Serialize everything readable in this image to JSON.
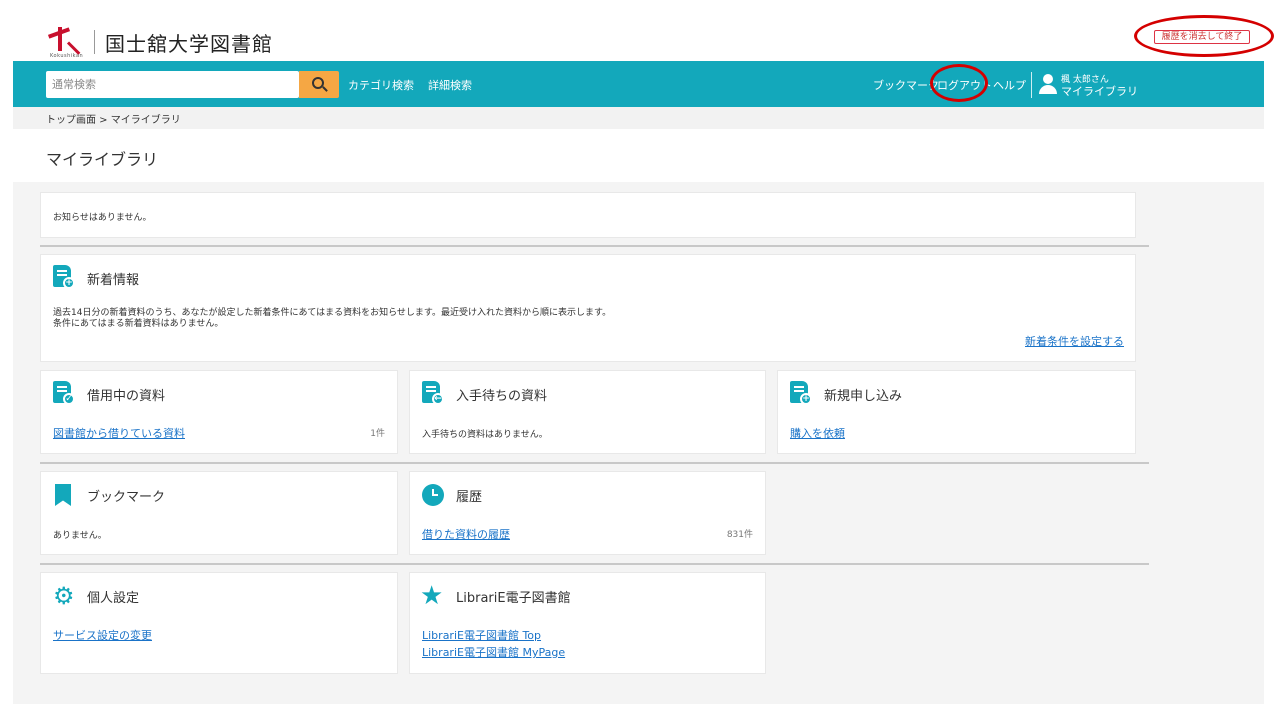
{
  "header": {
    "logo_sub": "Kokushikan",
    "logo_text": "国士舘大学図書館",
    "exit_button": "履歴を消去して終了"
  },
  "nav": {
    "search_placeholder": "通常検索",
    "category_search": "カテゴリ検索",
    "advanced_search": "詳細検索",
    "bookmark": "ブックマーク",
    "logout": "ログアウト",
    "help": "ヘルプ",
    "user_name": "楓 太郎さん",
    "my_library": "マイライブラリ"
  },
  "breadcrumb": "トップ画面 > マイライブラリ",
  "page_title": "マイライブラリ",
  "notice": {
    "text": "お知らせはありません。"
  },
  "new_arrivals": {
    "title": "新着情報",
    "desc1": "過去14日分の新着資料のうち、あなたが設定した新着条件にあてはまる資料をお知らせします。最近受け入れた資料から順に表示します。",
    "desc2": "条件にあてはまる新着資料はありません。",
    "link": "新着条件を設定する"
  },
  "borrowing": {
    "title": "借用中の資料",
    "link": "図書館から借りている資料",
    "count": "1件"
  },
  "waiting": {
    "title": "入手待ちの資料",
    "text": "入手待ちの資料はありません。"
  },
  "new_request": {
    "title": "新規申し込み",
    "link": "購入を依頼"
  },
  "bookmarks": {
    "title": "ブックマーク",
    "text": "ありません。"
  },
  "history": {
    "title": "履歴",
    "link": "借りた資料の履歴",
    "count": "831件"
  },
  "settings": {
    "title": "個人設定",
    "link": "サービス設定の変更"
  },
  "librarie": {
    "title": "LibrariE電子図書館",
    "link1": "LibrariE電子図書館 Top",
    "link2": "LibrariE電子図書館 MyPage"
  },
  "colors": {
    "accent": "#13a8bb",
    "search_button": "#f5a744",
    "link": "#1a73c8",
    "highlight_ring": "#d40000"
  }
}
